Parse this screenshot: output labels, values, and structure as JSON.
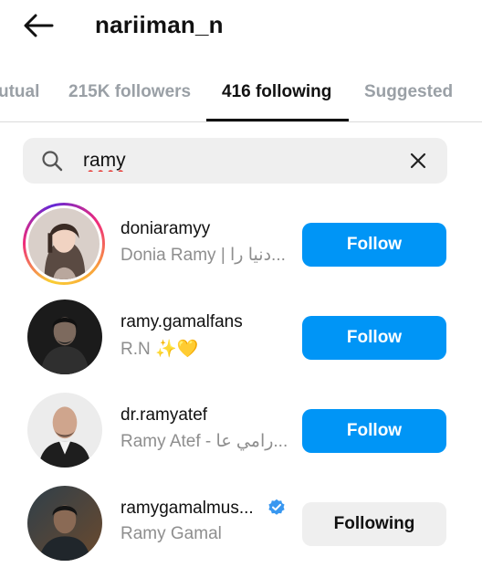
{
  "header": {
    "title": "nariiman_n",
    "back_icon": "arrow-left-icon"
  },
  "tabs": [
    {
      "label": "utual",
      "active": false
    },
    {
      "label": "215K followers",
      "active": false
    },
    {
      "label": "416 following",
      "active": true
    },
    {
      "label": "Suggested",
      "active": false
    }
  ],
  "search": {
    "value": "ramy",
    "icon": "search-icon",
    "clear_icon": "close-icon"
  },
  "results": [
    {
      "username": "doniaramyy",
      "full_name": "Donia Ramy | دنيا را...",
      "button": "Follow",
      "story_ring": true,
      "verified": false
    },
    {
      "username": "ramy.gamalfans",
      "full_name": "R.N ✨💛",
      "button": "Follow",
      "story_ring": false,
      "verified": false
    },
    {
      "username": "dr.ramyatef",
      "full_name": "Ramy Atef - رامي عا...",
      "button": "Follow",
      "story_ring": false,
      "verified": false
    },
    {
      "username": "ramygamalmus...",
      "full_name": "Ramy Gamal",
      "button": "Following",
      "story_ring": false,
      "verified": true
    }
  ],
  "colors": {
    "follow_button": "#0095f6",
    "following_button": "#efefef",
    "verified_badge": "#3897f0",
    "secondary_text": "#8e8e8e"
  }
}
